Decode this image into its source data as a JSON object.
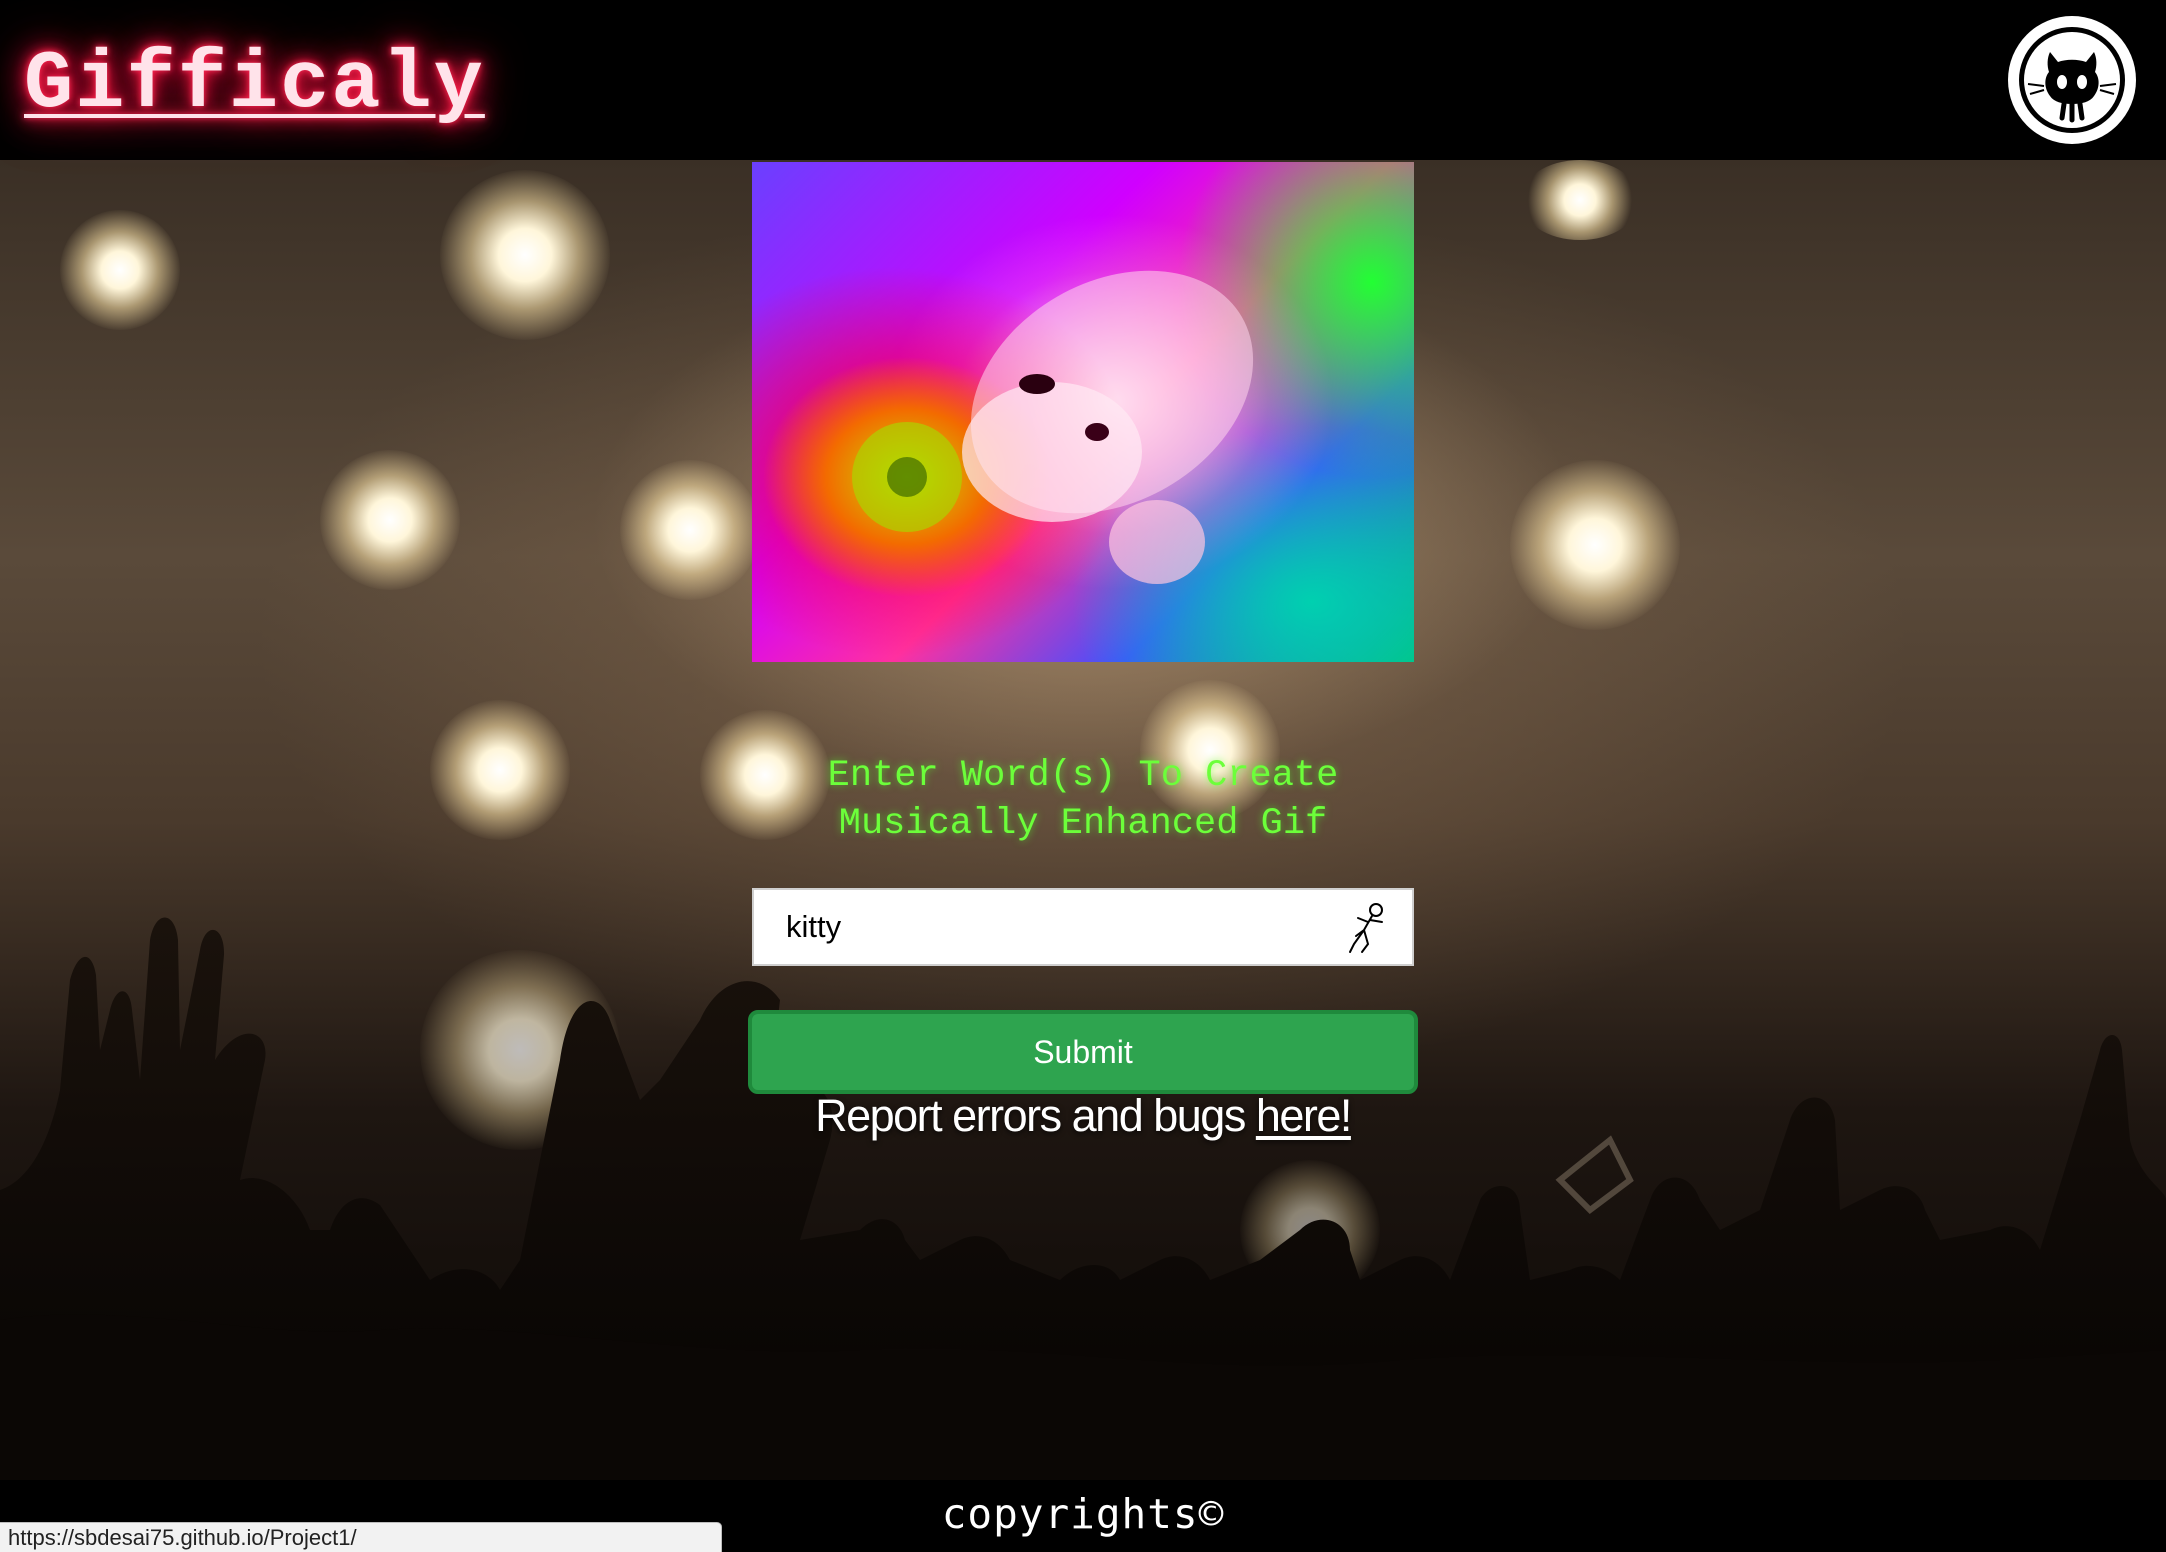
{
  "header": {
    "logo_text": "Gifficaly",
    "github_icon": "github-octocat-icon"
  },
  "main": {
    "prompt_line1": "Enter Word(s) To Create",
    "prompt_line2": "Musically Enhanced Gif",
    "search": {
      "value": "kitty",
      "trailing_icon": "dancer-icon"
    },
    "submit_label": "Submit",
    "report_prefix": "Report errors and bugs ",
    "report_link": "here!"
  },
  "footer": {
    "copyright": "copyrights©"
  },
  "status_bar": {
    "url": "https://sbdesai75.github.io/Project1/"
  },
  "colors": {
    "logo_glow": "#ff1744",
    "prompt_text": "#6cff3a",
    "submit_bg": "#2ea44f"
  }
}
